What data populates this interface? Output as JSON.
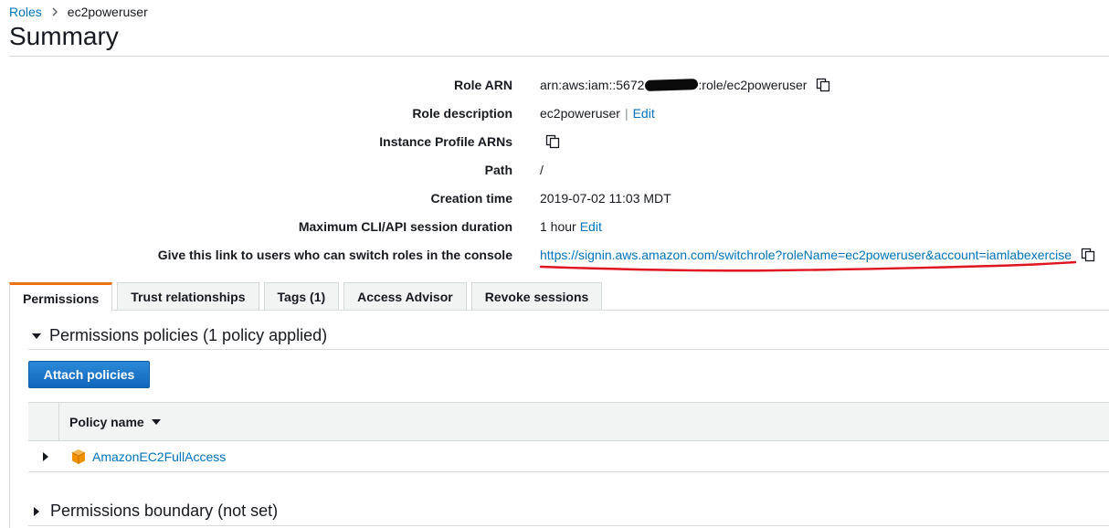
{
  "breadcrumb": {
    "root": "Roles",
    "separator": ">",
    "current": "ec2poweruser"
  },
  "page": {
    "title": "Summary"
  },
  "summary": {
    "role_arn": {
      "label": "Role ARN",
      "prefix": "arn:aws:iam::5672",
      "suffix": ":role/ec2poweruser"
    },
    "role_description": {
      "label": "Role description",
      "value": "ec2poweruser",
      "separator": "|",
      "edit": "Edit"
    },
    "instance_profile": {
      "label": "Instance Profile ARNs"
    },
    "path": {
      "label": "Path",
      "value": "/"
    },
    "creation_time": {
      "label": "Creation time",
      "value": "2019-07-02 11:03 MDT"
    },
    "max_session": {
      "label": "Maximum CLI/API session duration",
      "value": "1 hour",
      "edit": "Edit"
    },
    "switch_link": {
      "label": "Give this link to users who can switch roles in the console",
      "url": "https://signin.aws.amazon.com/switchrole?roleName=ec2poweruser&account=iamlabexercise"
    }
  },
  "tabs": [
    {
      "label": "Permissions",
      "active": true
    },
    {
      "label": "Trust relationships"
    },
    {
      "label": "Tags (1)"
    },
    {
      "label": "Access Advisor"
    },
    {
      "label": "Revoke sessions"
    }
  ],
  "permissions": {
    "policies_heading": "Permissions policies (1 policy applied)",
    "attach_button": "Attach policies",
    "table": {
      "column_policy_name": "Policy name",
      "rows": [
        {
          "name": "AmazonEC2FullAccess"
        }
      ]
    },
    "boundary_heading": "Permissions boundary (not set)"
  },
  "colors": {
    "link": "#0073bb",
    "active_tab_accent": "#ec7211",
    "primary_button": "#1166bb",
    "annotation_underline": "#e0141e",
    "policy_icon": "#f29100"
  },
  "icons": [
    "chevron-right-icon",
    "copy-icon",
    "caret-down-icon",
    "caret-right-icon",
    "sort-caret-icon",
    "aws-policy-cube-icon"
  ]
}
